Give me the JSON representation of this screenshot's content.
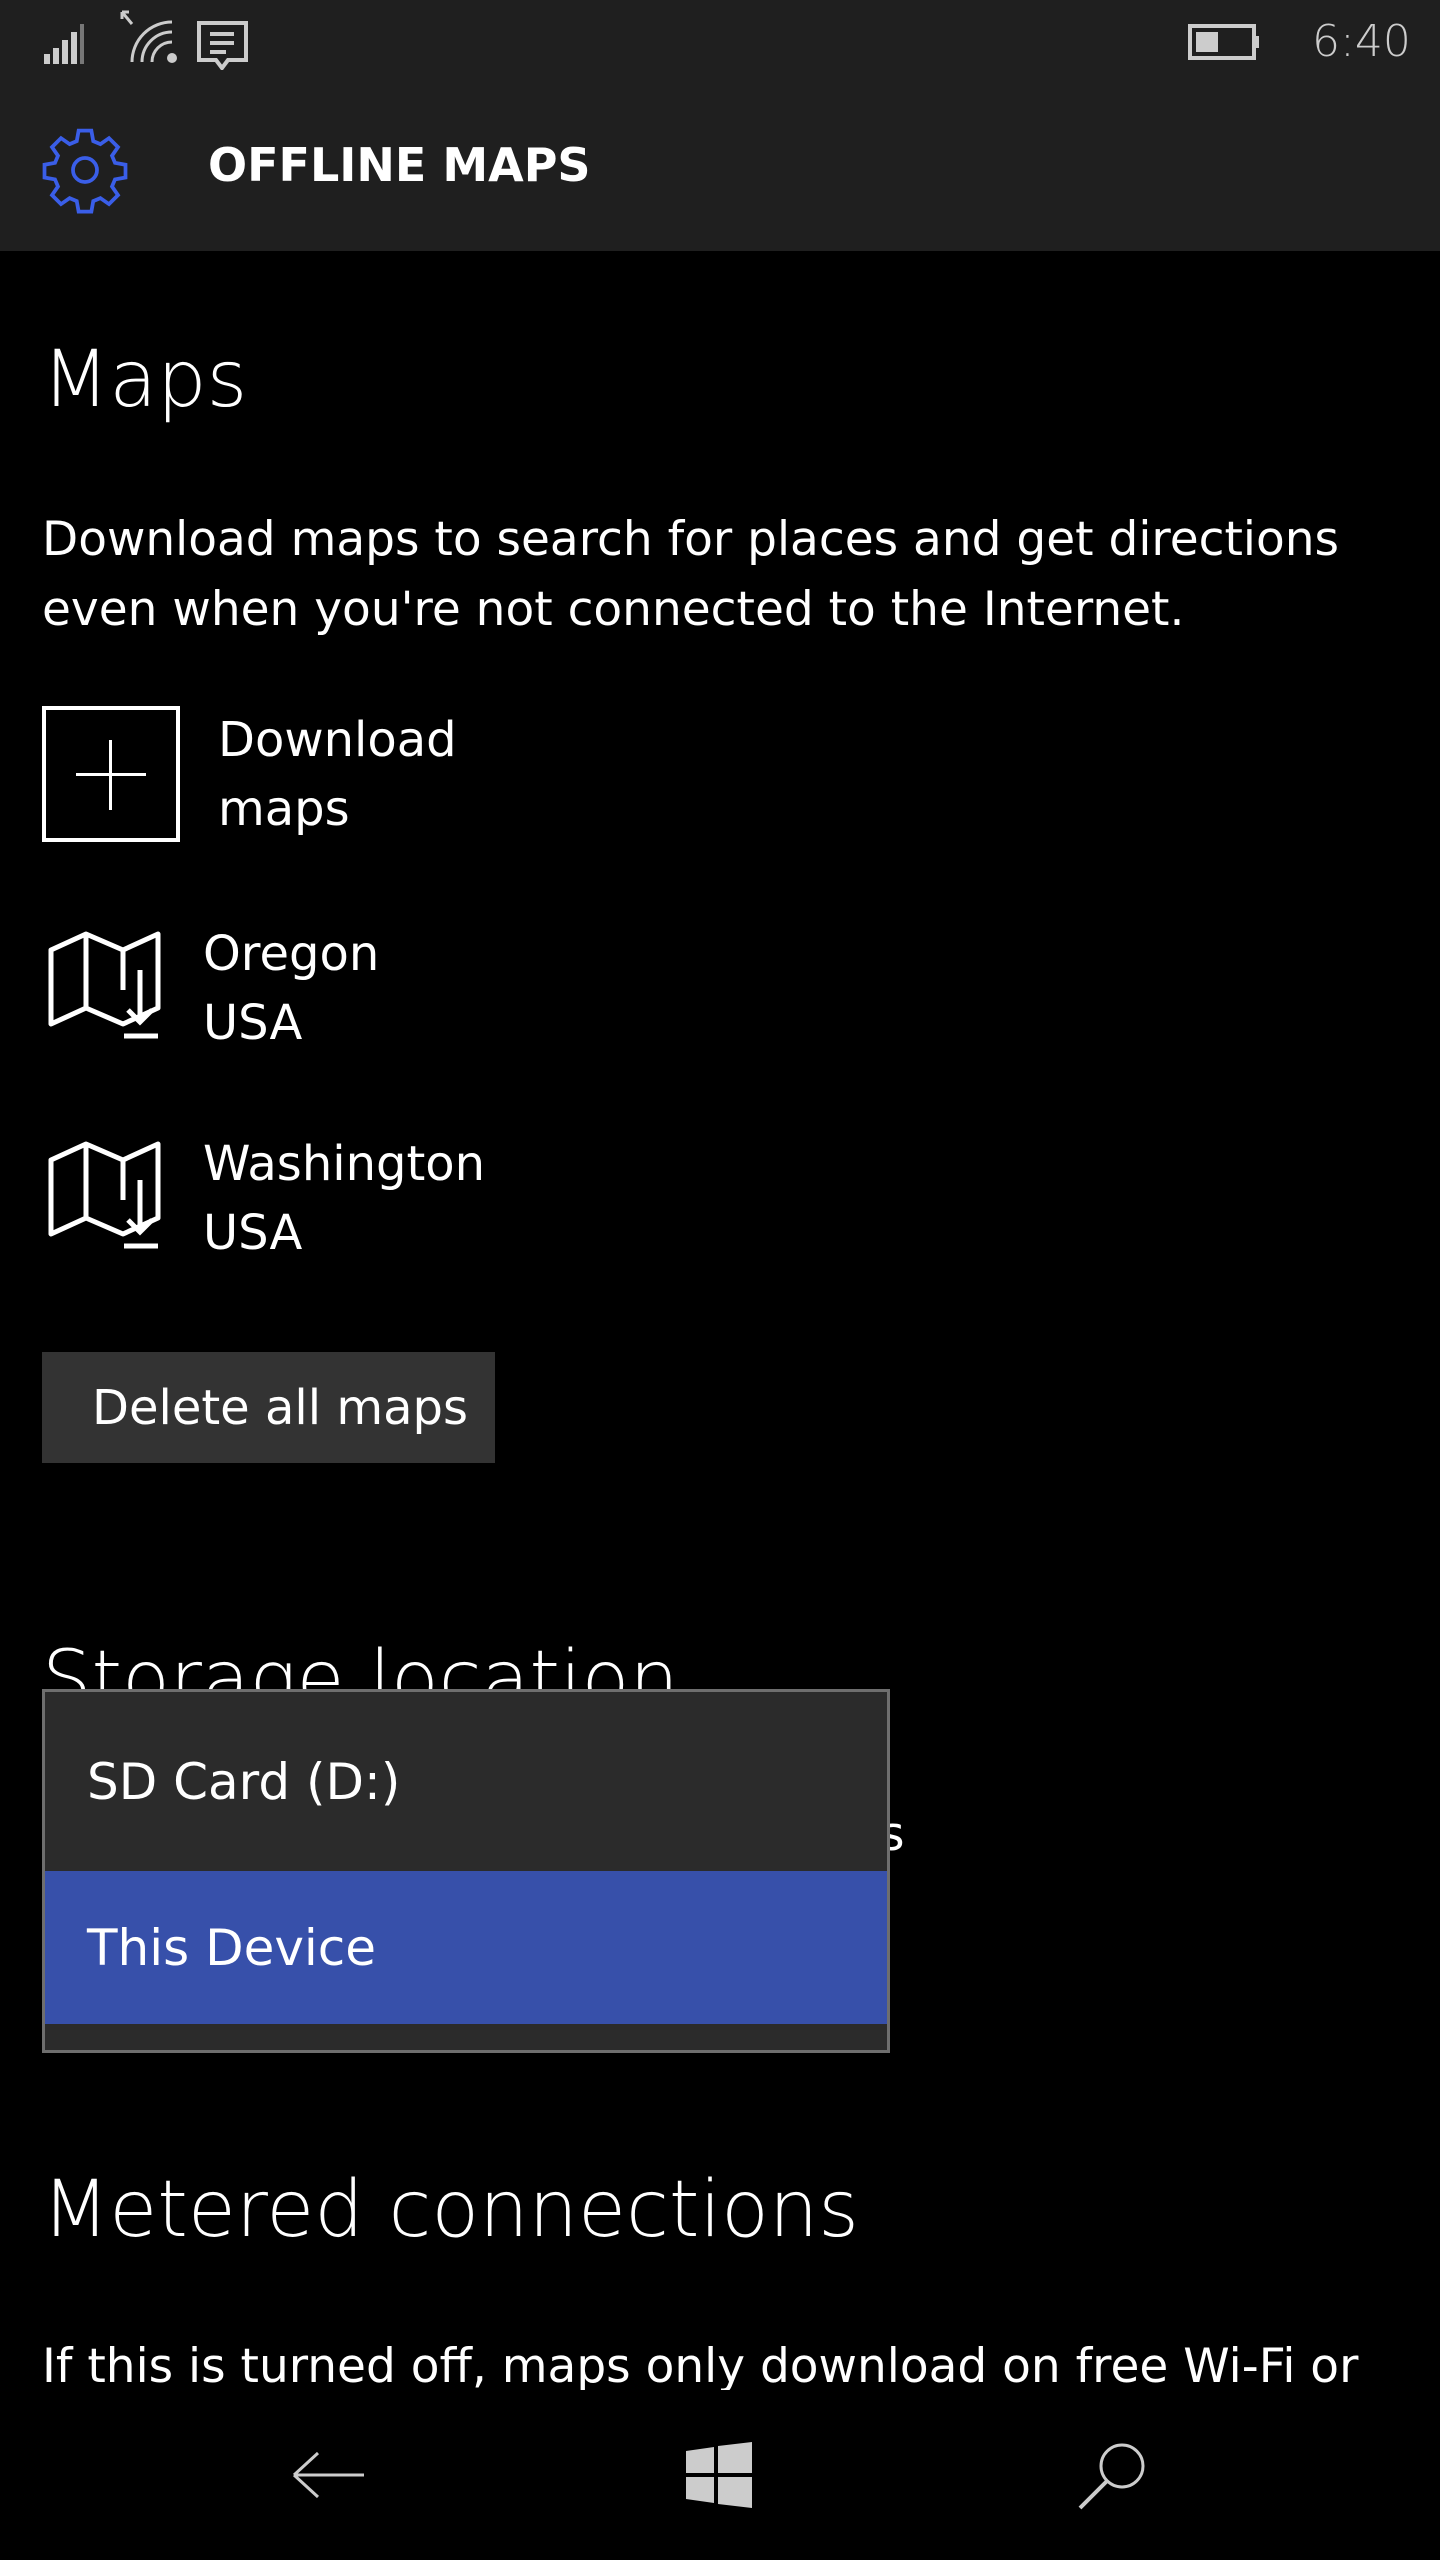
{
  "status_bar": {
    "time": "6:40",
    "icons": [
      "signal-icon",
      "wifi-icon",
      "message-icon",
      "battery-icon"
    ]
  },
  "header": {
    "title": "OFFLINE MAPS",
    "icon": "gear-icon",
    "accent": "#3a5ee8"
  },
  "maps": {
    "heading": "Maps",
    "description_line1": "Download maps to search for places and get directions",
    "description_line2": "even when you're not connected to the Internet.",
    "download_label": "Download maps",
    "items": [
      {
        "name": "Oregon",
        "country": "USA"
      },
      {
        "name": "Washington",
        "country": "USA"
      }
    ],
    "delete_label": "Delete all maps"
  },
  "storage": {
    "heading": "Storage location",
    "hidden_text_fragment": "s",
    "options": [
      "SD Card (D:)",
      "This Device"
    ],
    "selected": "This Device",
    "selected_color": "#3750aa"
  },
  "metered": {
    "heading": "Metered connections",
    "description": "If this is turned off, maps only download on free Wi-Fi or"
  },
  "nav": {
    "icons": [
      "back-icon",
      "windows-icon",
      "search-icon"
    ]
  }
}
